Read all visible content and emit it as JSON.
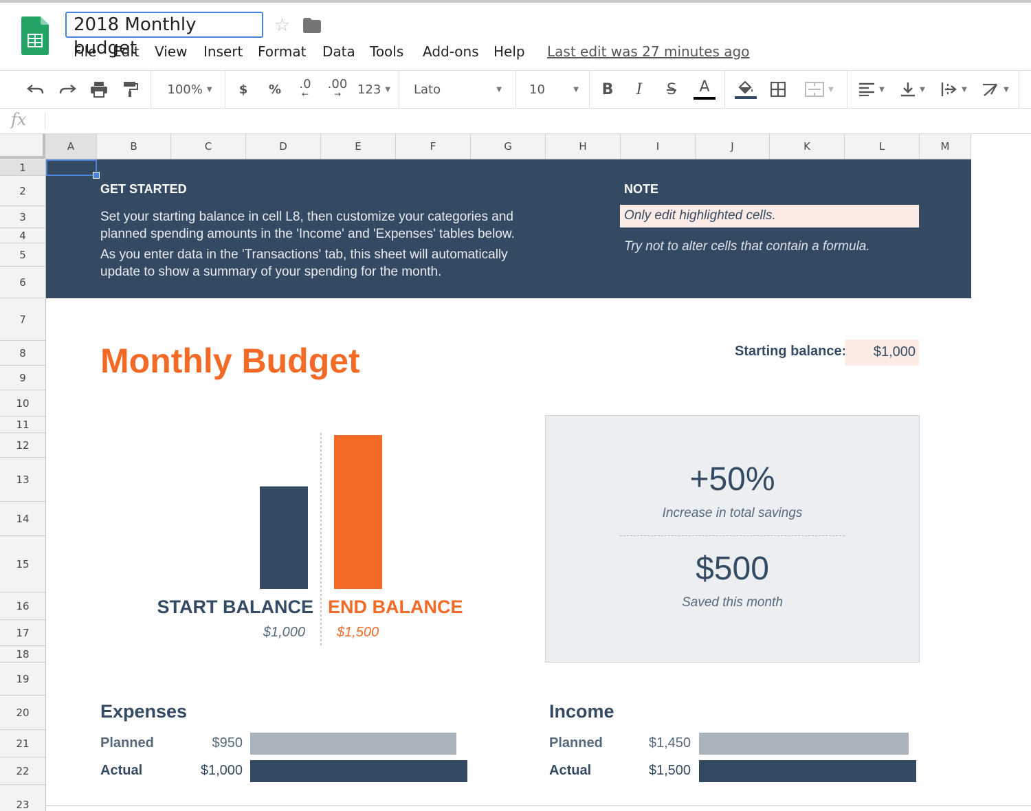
{
  "app": {
    "doc_title": "2018 Monthly budget",
    "menu": [
      "File",
      "Edit",
      "View",
      "Insert",
      "Format",
      "Data",
      "Tools",
      "Add-ons",
      "Help"
    ],
    "last_edit": "Last edit was 27 minutes ago",
    "icons": [
      "sheets-logo-icon",
      "star-icon",
      "folder-icon"
    ]
  },
  "toolbar": {
    "zoom": "100%",
    "currency": "$",
    "percent": "%",
    "decrease_decimals": ".0",
    "increase_decimals": ".00",
    "more_formats": "123",
    "font": "Lato",
    "font_size": "10",
    "bold": "B",
    "italic": "I",
    "strike": "S",
    "text_color_letter": "A",
    "text_color": "#000000",
    "fill_color": "#344a62"
  },
  "formula_bar": {
    "fx": "fx",
    "value": ""
  },
  "grid": {
    "columns": [
      "A",
      "B",
      "C",
      "D",
      "E",
      "F",
      "G",
      "H",
      "I",
      "J",
      "K",
      "L",
      "M"
    ],
    "rows": [
      "1",
      "2",
      "3",
      "4",
      "5",
      "6",
      "7",
      "8",
      "9",
      "10",
      "11",
      "12",
      "13",
      "14",
      "15",
      "16",
      "17",
      "18",
      "19",
      "20",
      "21",
      "22",
      "23"
    ],
    "selected_cell": "A1"
  },
  "banner": {
    "get_started_title": "GET STARTED",
    "get_started_line1": "Set your starting balance in cell L8, then customize your categories and",
    "get_started_line2": "planned spending amounts in the 'Income' and 'Expenses' tables below.",
    "get_started_line3": "As you enter data in the 'Transactions' tab, this sheet will automatically",
    "get_started_line4": "update to show a summary of your spending for the month.",
    "note_title": "NOTE",
    "note_line1": "Only edit highlighted cells.",
    "note_line2": "Try not to alter cells that contain a formula."
  },
  "sheet": {
    "title": "Monthly Budget",
    "starting_balance_label": "Starting balance:",
    "starting_balance_value": "$1,000"
  },
  "chart_data": {
    "type": "bar",
    "categories": [
      "START BALANCE",
      "END BALANCE"
    ],
    "values": [
      1000,
      1500
    ],
    "value_labels": [
      "$1,000",
      "$1,500"
    ],
    "colors": [
      "#344a62",
      "#f26a25"
    ]
  },
  "savings": {
    "percent": "+50%",
    "percent_label": "Increase in total savings",
    "amount": "$500",
    "amount_label": "Saved this month"
  },
  "expenses": {
    "title": "Expenses",
    "planned_label": "Planned",
    "planned_value": "$950",
    "planned_amount": 950,
    "actual_label": "Actual",
    "actual_value": "$1,000",
    "actual_amount": 1000
  },
  "income": {
    "title": "Income",
    "planned_label": "Planned",
    "planned_value": "$1,450",
    "planned_amount": 1450,
    "actual_label": "Actual",
    "actual_value": "$1,500",
    "actual_amount": 1500
  },
  "colors": {
    "navy": "#344a62",
    "orange": "#f26a25",
    "highlight": "#fdece6",
    "planned_bar": "#aab3bb",
    "selection": "#4a84d8"
  }
}
